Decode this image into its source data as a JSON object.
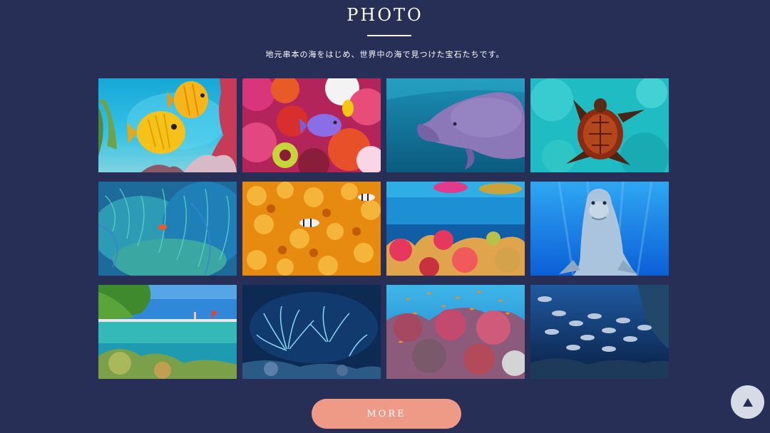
{
  "section": {
    "title": "PHOTO",
    "subtitle": "地元串本の海をはじめ、世界中の海で見つけた宝石たちです。"
  },
  "gallery": {
    "photos": [
      {
        "subject": "yellow-butterflyfish-coral-reef"
      },
      {
        "subject": "colorful-coral-fish"
      },
      {
        "subject": "manatee"
      },
      {
        "subject": "sea-turtle"
      },
      {
        "subject": "blue-sea-anemone-clownfish"
      },
      {
        "subject": "orange-coral-clownfish"
      },
      {
        "subject": "split-view-coral-reef"
      },
      {
        "subject": "dolphin"
      },
      {
        "subject": "tropical-island-split-view"
      },
      {
        "subject": "blue-anemone-night"
      },
      {
        "subject": "soft-coral-school-of-fish"
      },
      {
        "subject": "school-of-fish-dark-reef"
      }
    ]
  },
  "more_button": {
    "label": "MORE"
  },
  "page_top_button": {
    "icon": "arrow-up-icon"
  },
  "colors": {
    "background": "#272f56",
    "accent": "#ee9a87",
    "page_top": "#d7dbe6"
  }
}
